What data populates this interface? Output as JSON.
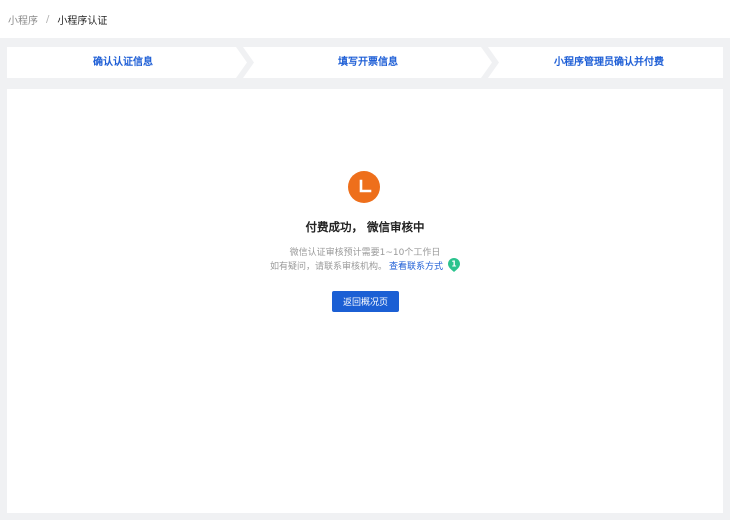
{
  "breadcrumb": {
    "parent": "小程序",
    "separator": "/",
    "current": "小程序认证"
  },
  "steps": [
    {
      "label": "确认认证信息"
    },
    {
      "label": "填写开票信息"
    },
    {
      "label": "小程序管理员确认并付费"
    }
  ],
  "status": {
    "icon": "clock-icon",
    "icon_color": "#ee6f1b",
    "title": "付费成功， 微信审核中",
    "desc_line1": "微信认证审核预计需要1~10个工作日",
    "desc_line2": "如有疑问，请联系审核机构。",
    "contact_link": "查看联系方式",
    "badge": "1",
    "badge_color": "#2bc38e"
  },
  "actions": {
    "back_label": "返回概况页"
  },
  "colors": {
    "accent": "#1b5fd4",
    "background": "#f0f1f3"
  }
}
